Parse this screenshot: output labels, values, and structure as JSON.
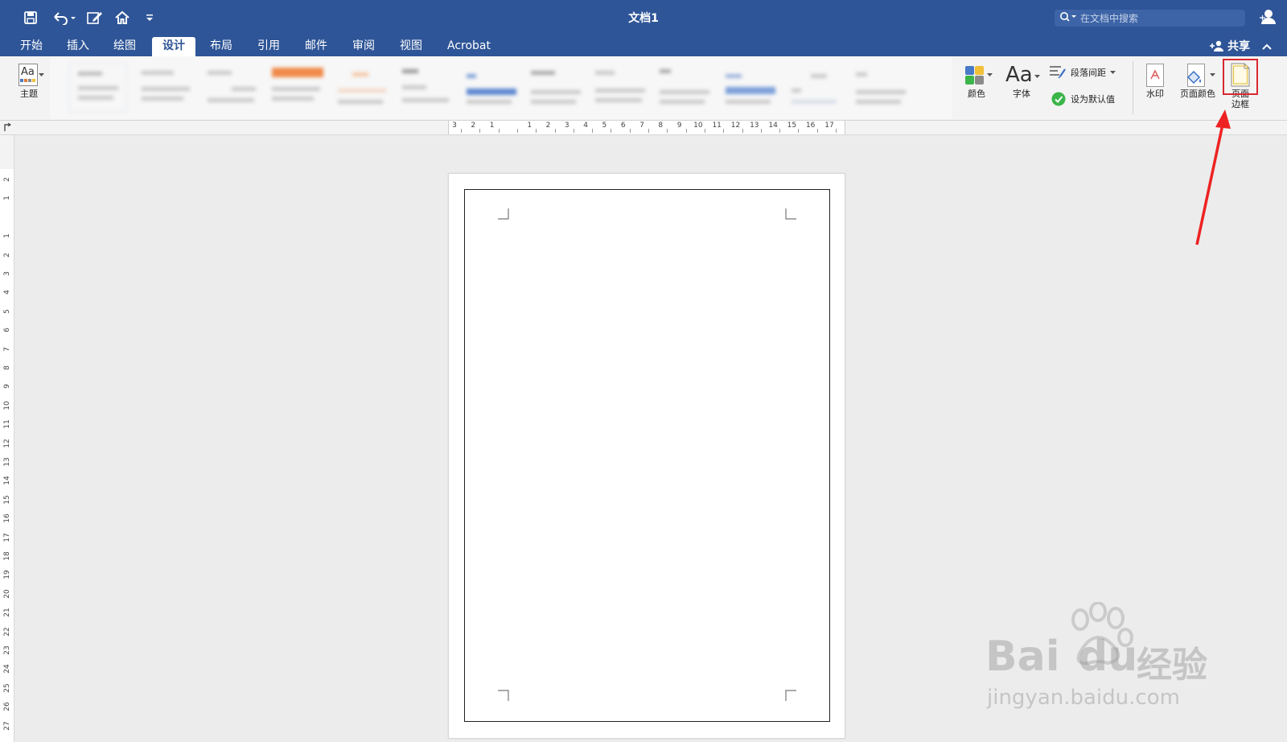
{
  "window": {
    "title": "文档1"
  },
  "search": {
    "placeholder": "在文档中搜索"
  },
  "tabs": [
    {
      "label": "开始"
    },
    {
      "label": "插入"
    },
    {
      "label": "绘图"
    },
    {
      "label": "设计"
    },
    {
      "label": "布局"
    },
    {
      "label": "引用"
    },
    {
      "label": "邮件"
    },
    {
      "label": "审阅"
    },
    {
      "label": "视图"
    },
    {
      "label": "Acrobat"
    }
  ],
  "active_tab": "设计",
  "share": {
    "label": "共享"
  },
  "ribbon": {
    "theme": {
      "icon_text": "Aa",
      "label": "主题"
    },
    "colors": {
      "label": "颜色"
    },
    "fonts": {
      "icon_text": "Aa",
      "label": "字体"
    },
    "paragraph_spacing": {
      "label": "段落间距"
    },
    "set_default": {
      "label": "设为默认值"
    },
    "watermark": {
      "label": "水印"
    },
    "page_color": {
      "label": "页面颜色"
    },
    "page_border": {
      "label_line1": "页面",
      "label_line2": "边框"
    }
  },
  "ruler": {
    "horizontal_labels": [
      "3",
      "2",
      "1",
      "",
      "1",
      "2",
      "3",
      "4",
      "5",
      "6",
      "7",
      "8",
      "9",
      "10",
      "11",
      "12",
      "13",
      "14",
      "15",
      "16",
      "17"
    ],
    "vertical_labels": [
      "2",
      "1",
      "",
      "1",
      "2",
      "3",
      "4",
      "5",
      "6",
      "7",
      "8",
      "9",
      "10",
      "11",
      "12",
      "13",
      "14",
      "15",
      "16",
      "17",
      "18",
      "19",
      "20",
      "21",
      "22",
      "23",
      "24",
      "25",
      "26",
      "27"
    ]
  },
  "watermark_overlay": {
    "brand": "Bai",
    "brand_tail": "du",
    "cn": "经验",
    "url": "jingyan.baidu.com"
  },
  "colors": {
    "titlebar": "#2e5597",
    "highlight": "#d9272e",
    "check_green": "#3bb54a"
  }
}
